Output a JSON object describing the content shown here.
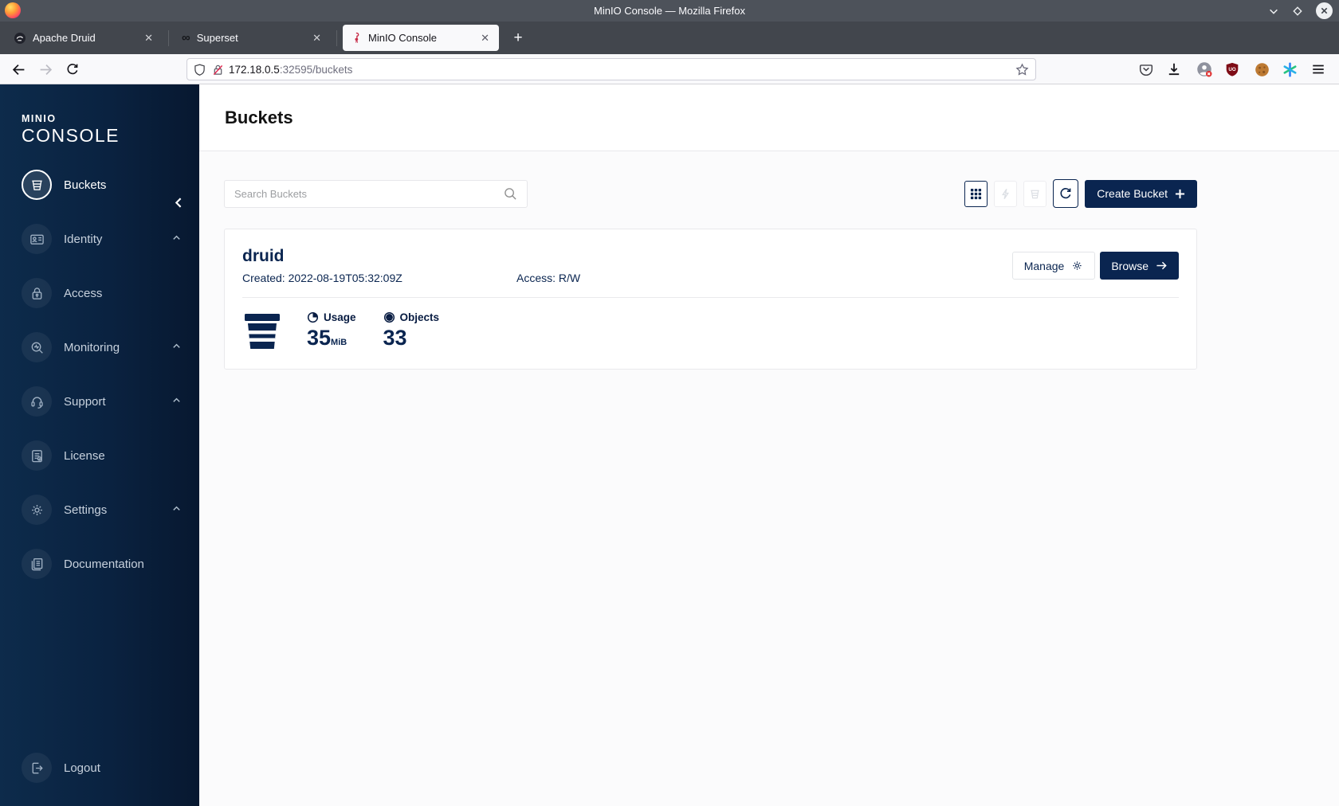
{
  "window": {
    "title": "MinIO Console — Mozilla Firefox"
  },
  "tabs": {
    "items": [
      {
        "title": "Apache Druid"
      },
      {
        "title": "Superset"
      },
      {
        "title": "MinIO Console"
      }
    ]
  },
  "navbar": {
    "url_host": "172.18.0.5",
    "url_rest": ":32595/buckets"
  },
  "sidebar": {
    "logo_top": "MINIO",
    "logo_bottom": "CONSOLE",
    "items": [
      {
        "label": "Buckets"
      },
      {
        "label": "Identity"
      },
      {
        "label": "Access"
      },
      {
        "label": "Monitoring"
      },
      {
        "label": "Support"
      },
      {
        "label": "License"
      },
      {
        "label": "Settings"
      },
      {
        "label": "Documentation"
      }
    ],
    "logout_label": "Logout"
  },
  "page": {
    "title": "Buckets",
    "search_placeholder": "Search Buckets",
    "create_button": "Create Bucket"
  },
  "bucket": {
    "name": "druid",
    "created": "Created: 2022-08-19T05:32:09Z",
    "access": "Access: R/W",
    "manage_label": "Manage",
    "browse_label": "Browse",
    "usage_label": "Usage",
    "usage_value": "35",
    "usage_unit": "MiB",
    "objects_label": "Objects",
    "objects_value": "33"
  },
  "colors": {
    "navy": "#0a2550",
    "sidebar_dark": "#071830",
    "flamingo_red": "#c72c48"
  }
}
